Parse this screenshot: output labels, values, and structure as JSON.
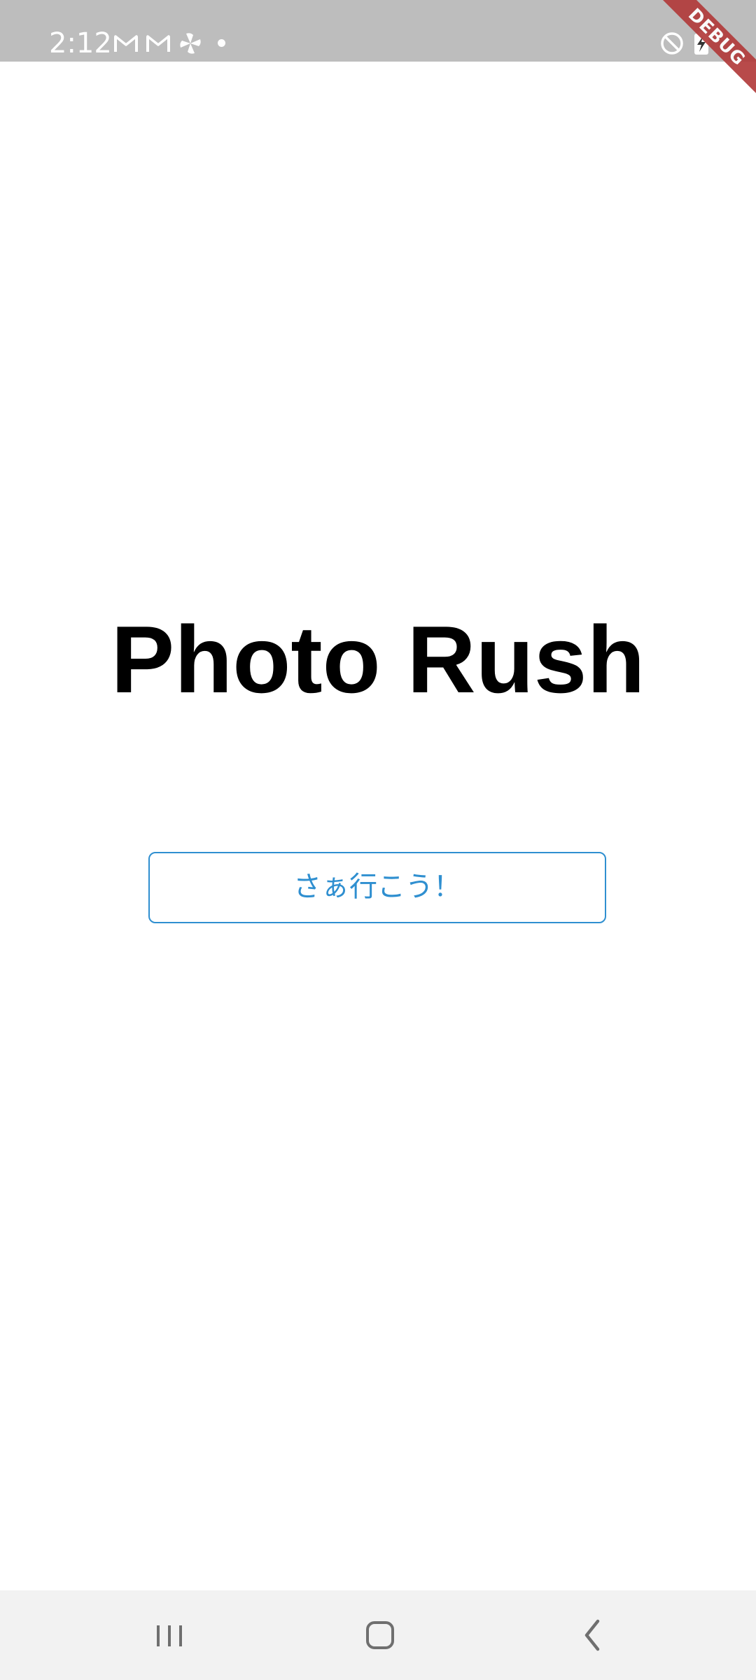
{
  "status_bar": {
    "time": "2:12",
    "icons": [
      "gmail-icon",
      "gmail-icon",
      "pinwheel-icon",
      "notification-dot-icon",
      "do-not-disturb-icon",
      "battery-charging-icon"
    ],
    "background": "#bdbdbd"
  },
  "debug_banner": {
    "label": "DEBUG",
    "color": "#b23b3b"
  },
  "main": {
    "title": "Photo Rush",
    "start_button_label": "さぁ行こう！",
    "accent_color": "#2f8fd0"
  },
  "nav_bar": {
    "buttons": [
      "recent-apps-icon",
      "home-icon",
      "back-icon"
    ]
  }
}
